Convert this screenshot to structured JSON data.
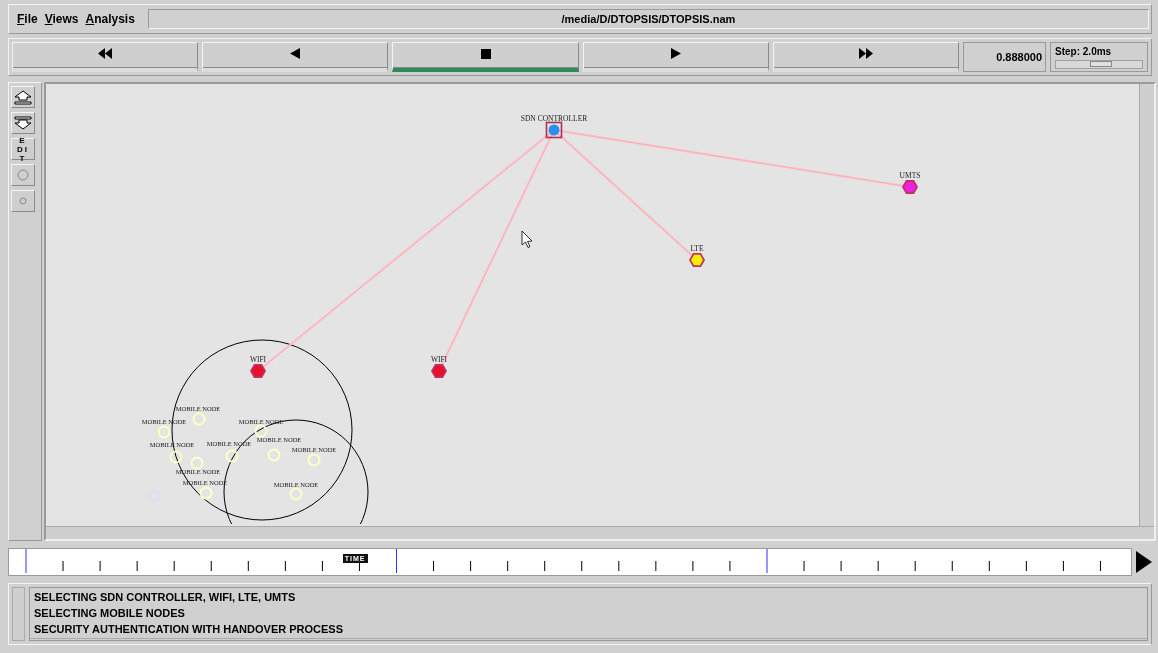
{
  "menu": [
    {
      "label": "File"
    },
    {
      "label": "Views"
    },
    {
      "label": "Analysis"
    }
  ],
  "file_path": "/media/D/DTOPSIS/DTOPSIS.nam",
  "playback": [
    {
      "kind": "rewind",
      "selected": false
    },
    {
      "kind": "back",
      "selected": false
    },
    {
      "kind": "stop",
      "selected": true
    },
    {
      "kind": "play",
      "selected": false
    },
    {
      "kind": "fast-forward",
      "selected": false
    }
  ],
  "time": "0.888000",
  "step": {
    "label": "Step: 2.0ms",
    "level": 0.52
  },
  "tools": [
    {
      "kind": "zoom-in"
    },
    {
      "kind": "zoom-out"
    },
    {
      "kind": "text",
      "label": "EDIT"
    },
    {
      "kind": "large-circle"
    },
    {
      "kind": "small-circle"
    }
  ],
  "nodes": [
    {
      "kind": "controller",
      "label": "SDN CONTROLLER",
      "color": "#2f8cf0",
      "linked": false
    },
    {
      "kind": "station",
      "label": "WIFI",
      "color": "#e8102a",
      "linked": true
    },
    {
      "kind": "station",
      "label": "WIFI",
      "color": "#e8102a",
      "linked": true
    },
    {
      "kind": "station",
      "label": "LTE",
      "color": "#f5f000",
      "linked": true
    },
    {
      "kind": "station",
      "label": "UMTS",
      "color": "#f020e0",
      "linked": true
    },
    {
      "kind": "mobile",
      "label": "MOBILE NODE",
      "color": "#ffffc8",
      "linked": false
    },
    {
      "kind": "mobile",
      "label": "MOBILE NODE",
      "color": "#ffffc8",
      "linked": false
    },
    {
      "kind": "mobile",
      "label": "MOBILE NODE",
      "color": "#ffffc8",
      "linked": false
    },
    {
      "kind": "mobile",
      "label": "MOBILE NODE",
      "color": "#ffffc8",
      "linked": false
    },
    {
      "kind": "mobile",
      "label": "MOBILE NODE",
      "color": "#ffffc8",
      "linked": false
    },
    {
      "kind": "mobile",
      "label": "MOBILE NODE",
      "color": "#ffffc8",
      "linked": false
    },
    {
      "kind": "mobile",
      "label": "MOBILE NODE",
      "color": "#ffffc8",
      "linked": false
    },
    {
      "kind": "mobile",
      "label": "MOBILE NODE",
      "color": "#ffffc8",
      "linked": false
    },
    {
      "kind": "mobile",
      "label": "MOBILE NODE",
      "color": "#ffffc8",
      "linked": false
    },
    {
      "kind": "mobile",
      "label": "MOBILE NODE",
      "color": "#ffffc8",
      "linked": false
    },
    {
      "kind": "mobile",
      "color": "#dcdcf8",
      "linked": false
    }
  ],
  "timeline": {
    "marker": "TIME",
    "level": 0.31
  },
  "log": [
    "SELECTING SDN CONTROLLER, WIFI, LTE, UMTS",
    "SELECTING MOBILE NODES",
    "SECURITY AUTHENTICATION WITH HANDOVER PROCESS"
  ]
}
